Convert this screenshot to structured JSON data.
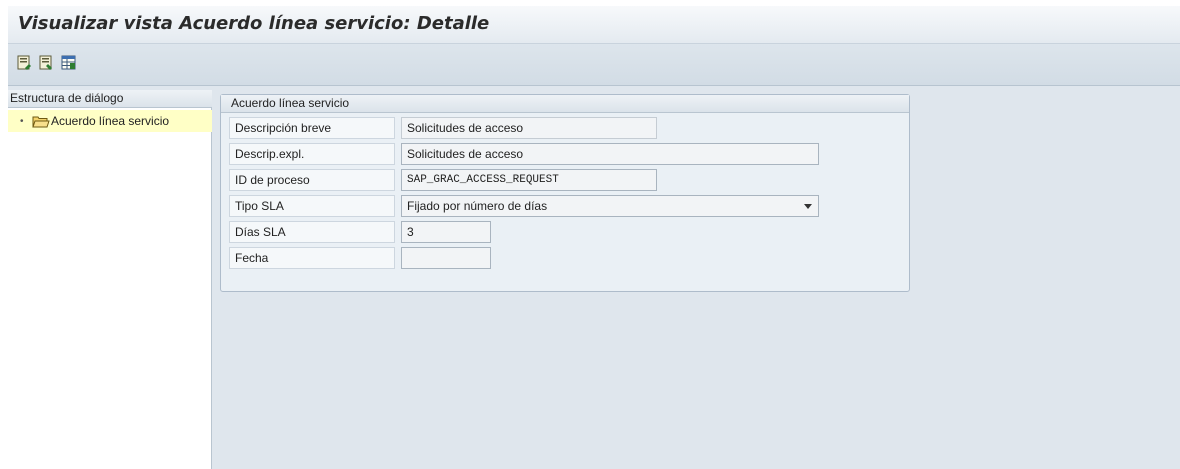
{
  "window": {
    "title": "Visualizar vista Acuerdo línea servicio: Detalle"
  },
  "toolbar": {
    "buttons": [
      {
        "icon": "display-previous-entry-icon"
      },
      {
        "icon": "display-next-entry-icon"
      },
      {
        "icon": "table-view-icon"
      }
    ]
  },
  "tree": {
    "header": "Estructura de diálogo",
    "items": [
      {
        "label": "Acuerdo línea servicio",
        "icon": "folder-open-icon",
        "selected": true
      }
    ]
  },
  "detail": {
    "group_title": "Acuerdo línea servicio",
    "fields": [
      {
        "label": "Descripción breve",
        "value": "Solicitudes de acceso"
      },
      {
        "label": "Descrip.expl.",
        "value": "Solicitudes de acceso"
      },
      {
        "label": "ID de proceso",
        "value": "SAP_GRAC_ACCESS_REQUEST"
      },
      {
        "label": "Tipo SLA",
        "value": "Fijado por número de días"
      },
      {
        "label": "Días SLA",
        "value": "3"
      },
      {
        "label": "Fecha",
        "value": ""
      }
    ]
  },
  "colors": {
    "title_bg": "#eef2f6",
    "toolbar_bg": "#d7e0e8",
    "selected_tree_item": "#ffffc6",
    "focus_marker": "#e0412a"
  }
}
